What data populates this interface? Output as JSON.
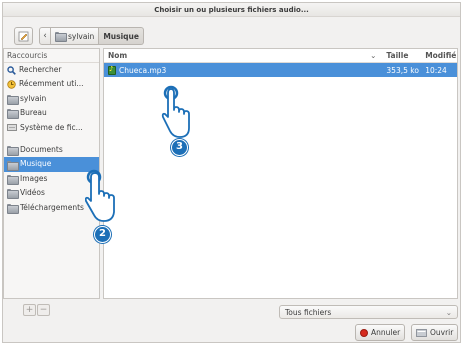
{
  "window": {
    "title": "Choisir un ou plusieurs fichiers audio..."
  },
  "pathbar": {
    "crumbs": [
      {
        "label": "sylvain"
      },
      {
        "label": "Musique"
      }
    ]
  },
  "sidebar": {
    "header": "Raccourcis",
    "items": [
      {
        "label": "Rechercher",
        "icon": "search-icon"
      },
      {
        "label": "Récemment uti...",
        "icon": "recent-icon"
      },
      {
        "label": "sylvain",
        "icon": "folder-icon"
      },
      {
        "label": "Bureau",
        "icon": "folder-icon"
      },
      {
        "label": "Système de fic...",
        "icon": "drive-icon"
      },
      {
        "label": "Documents",
        "icon": "folder-icon"
      },
      {
        "label": "Musique",
        "icon": "folder-icon",
        "selected": true
      },
      {
        "label": "Images",
        "icon": "folder-icon"
      },
      {
        "label": "Vidéos",
        "icon": "folder-icon"
      },
      {
        "label": "Téléchargements",
        "icon": "folder-icon"
      }
    ],
    "add_label": "+",
    "remove_label": "−"
  },
  "filelist": {
    "columns": {
      "name": "Nom",
      "size": "Taille",
      "modified": "Modifié",
      "sort_indicator": "⌄"
    },
    "rows": [
      {
        "name": "Chueca.mp3",
        "size": "353,5 ko",
        "modified": "10:24"
      }
    ]
  },
  "filter": {
    "selected": "Tous fichiers"
  },
  "buttons": {
    "cancel": "Annuler",
    "open": "Ouvrir"
  },
  "annotations": {
    "step2": "2",
    "step3": "3"
  },
  "colors": {
    "selection": "#4a90d9",
    "badge": "#1c6fb7",
    "cancel": "#d62a1e"
  }
}
